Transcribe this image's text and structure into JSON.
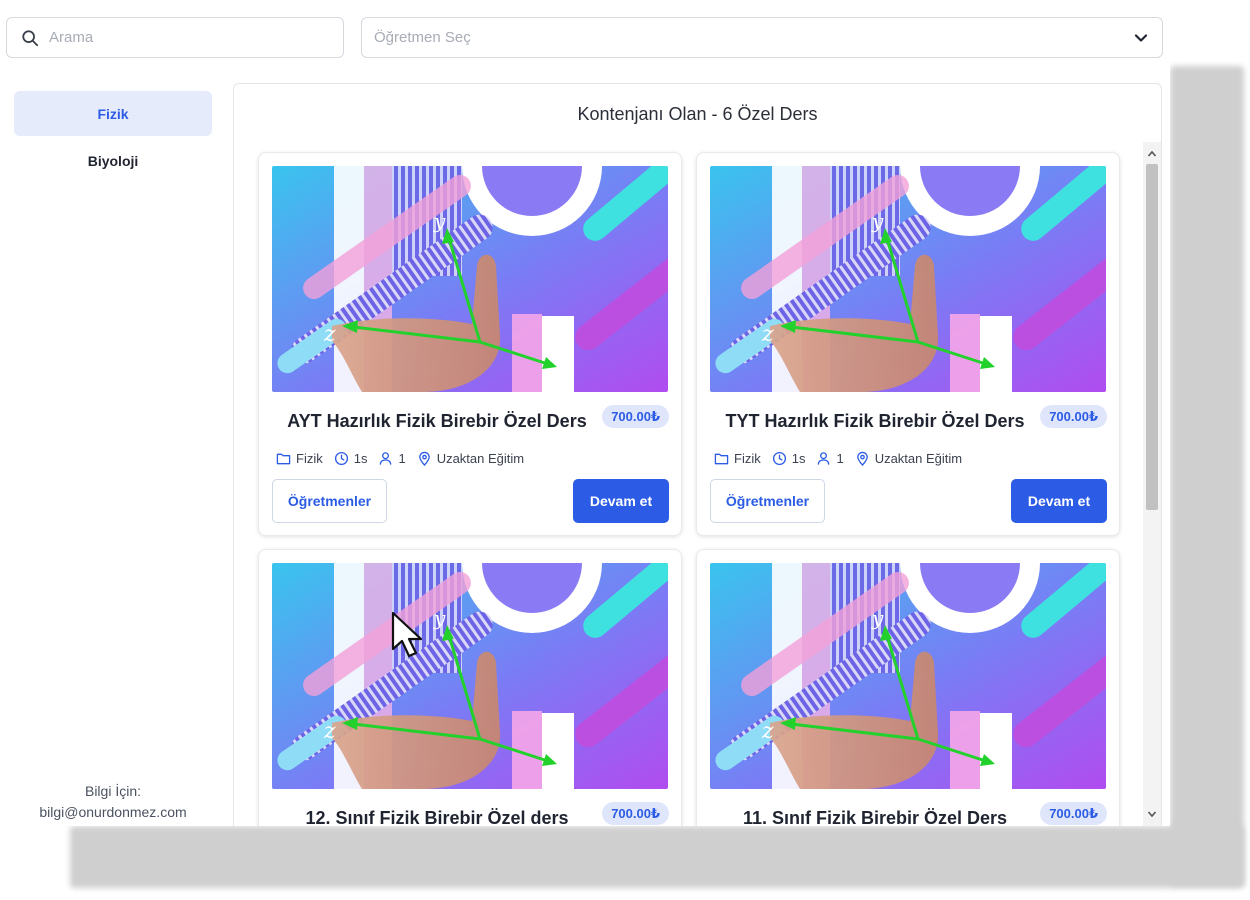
{
  "search": {
    "placeholder": "Arama",
    "icon": "search-icon"
  },
  "teacher_select": {
    "placeholder": "Öğretmen Seç",
    "icon": "chevron-down-icon"
  },
  "sidebar": {
    "items": [
      {
        "label": "Fizik",
        "active": true
      },
      {
        "label": "Biyoloji",
        "active": false
      }
    ],
    "footer_line1": "Bilgi İçin:",
    "footer_line2": "bilgi@onurdonmez.com"
  },
  "main": {
    "heading": "Kontenjanı Olan - 6 Özel Ders",
    "cards": [
      {
        "title": "AYT Hazırlık Fizik Birebir Özel Ders",
        "price": "700.00₺",
        "category": "Fizik",
        "duration": "1s",
        "capacity": "1",
        "location": "Uzaktan Eğitim",
        "teachers_label": "Öğretmenler",
        "continue_label": "Devam et"
      },
      {
        "title": "TYT Hazırlık Fizik Birebir Özel Ders",
        "price": "700.00₺",
        "category": "Fizik",
        "duration": "1s",
        "capacity": "1",
        "location": "Uzaktan Eğitim",
        "teachers_label": "Öğretmenler",
        "continue_label": "Devam et"
      },
      {
        "title": "12. Sınıf Fizik Birebir Özel ders",
        "price": "700.00₺"
      },
      {
        "title": "11. Sınıf Fizik Birebir Özel Ders",
        "price": "700.00₺"
      }
    ]
  },
  "colors": {
    "accent": "#2c5ce5",
    "accent_soft": "#e6ebfb",
    "price_bg": "#dfe6fb"
  }
}
